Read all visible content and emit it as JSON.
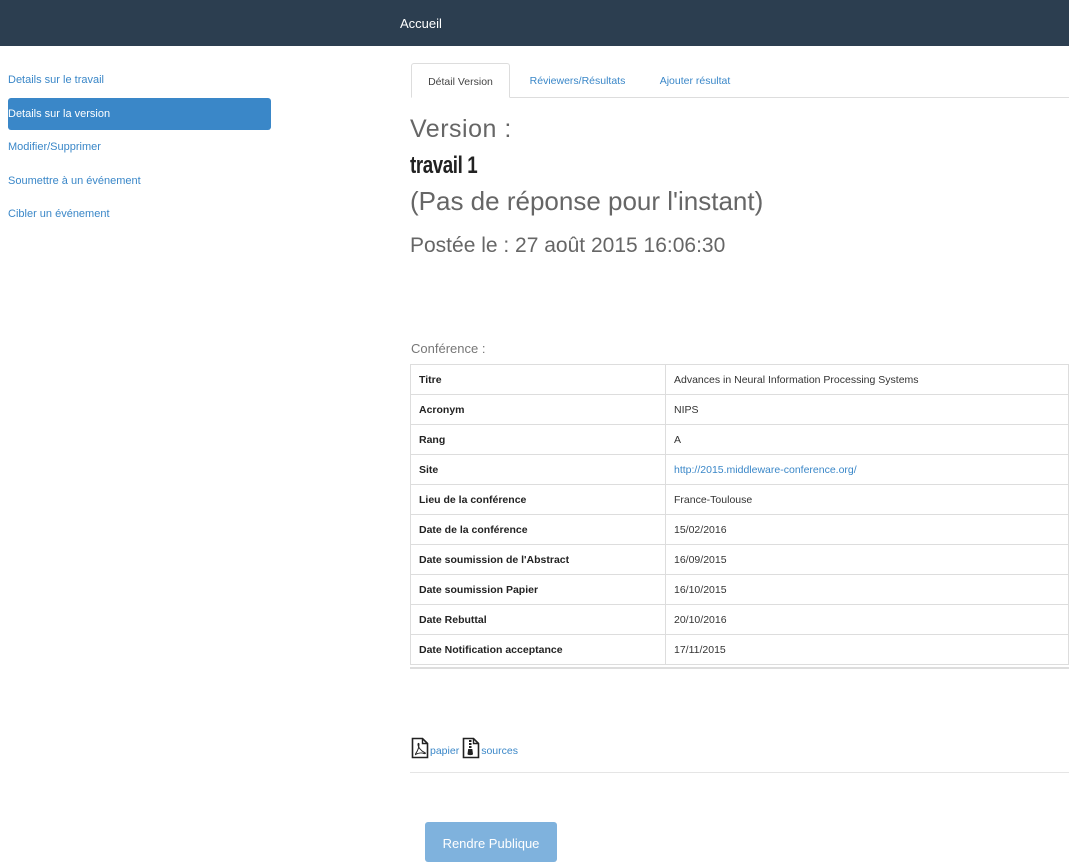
{
  "topbar": {
    "title": "Accueil"
  },
  "sidebar": {
    "items": [
      {
        "label": "Details sur le travail",
        "active": false
      },
      {
        "label": "Details sur la version",
        "active": true
      },
      {
        "label": "Modifier/Supprimer",
        "active": false
      },
      {
        "label": "Soumettre à un événement",
        "active": false
      },
      {
        "label": "Cibler un événement",
        "active": false
      }
    ]
  },
  "tabs": [
    {
      "label": "Détail Version",
      "active": true
    },
    {
      "label": "Réviewers/Résultats",
      "active": false
    },
    {
      "label": "Ajouter résultat",
      "active": false
    }
  ],
  "version": {
    "heading": "Version :",
    "title": "travail 1",
    "status": "(Pas de réponse pour l'instant)",
    "posted": "Postée le : 27 août 2015 16:06:30"
  },
  "conference": {
    "label": "Conférence :",
    "rows": [
      {
        "key": "Titre",
        "value": "Advances in Neural Information Processing Systems"
      },
      {
        "key": "Acronym",
        "value": "NIPS"
      },
      {
        "key": "Rang",
        "value": "A"
      },
      {
        "key": "Site",
        "value": "http://2015.middleware-conference.org/"
      },
      {
        "key": "Lieu de la conférence",
        "value": "France-Toulouse"
      },
      {
        "key": "Date de la conférence",
        "value": "15/02/2016"
      },
      {
        "key": "Date soumission de l'Abstract",
        "value": "16/09/2015"
      },
      {
        "key": "Date soumission Papier",
        "value": "16/10/2015"
      },
      {
        "key": "Date Rebuttal",
        "value": "20/10/2016"
      },
      {
        "key": "Date Notification acceptance",
        "value": "17/11/2015"
      }
    ]
  },
  "files": {
    "paper_label": "papier",
    "sources_label": "sources"
  },
  "actions": {
    "publish_label": "Rendre Publique"
  },
  "colors": {
    "topbar": "#2c3e50",
    "accent": "#3a87c8",
    "button": "#7fb2dd"
  }
}
